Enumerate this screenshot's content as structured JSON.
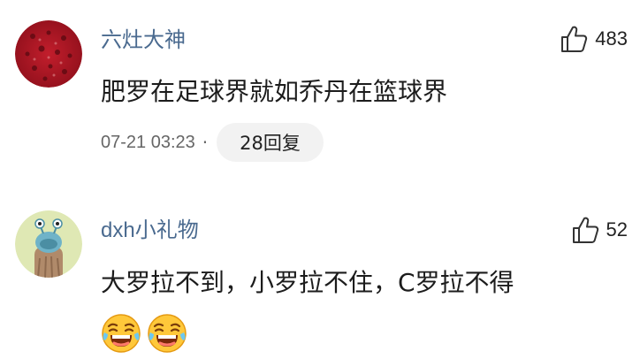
{
  "comments": [
    {
      "username": "六灶大神",
      "likes": "483",
      "text": "肥罗在足球界就如乔丹在篮球界",
      "time": "07-21 03:23",
      "separator": "·",
      "reply_label": "28回复",
      "avatar_icon": "red-pattern-avatar"
    },
    {
      "username": "dxh小礼物",
      "likes": "52",
      "text": "大罗拉不到，小罗拉不住，C罗拉不得",
      "emojis": [
        "laughing-crying-emoji",
        "laughing-crying-emoji"
      ],
      "avatar_icon": "cartoon-creature-avatar"
    }
  ],
  "colors": {
    "username": "#4a6a8f",
    "text": "#1c1c1c",
    "meta": "#666666",
    "reply_bg": "#f2f2f2"
  }
}
